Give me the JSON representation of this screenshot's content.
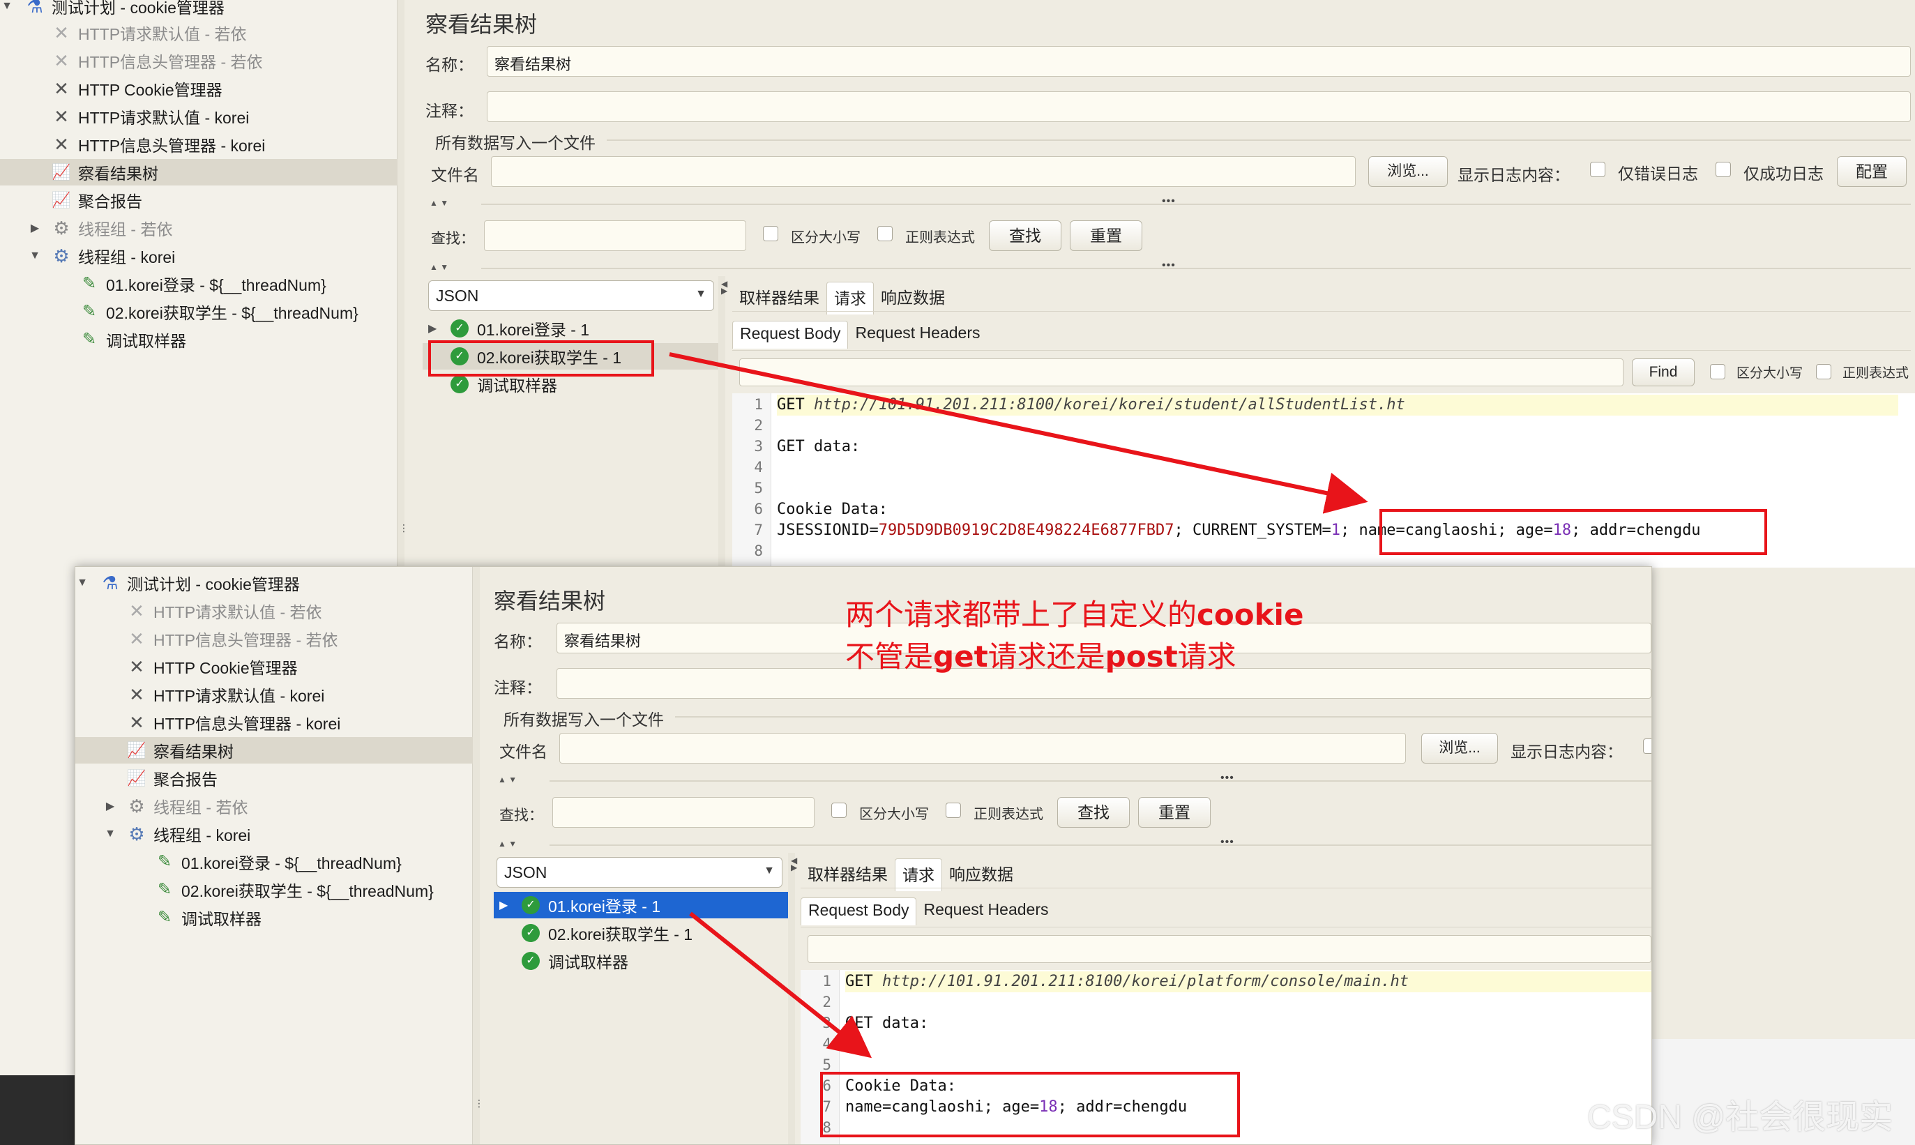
{
  "tree": {
    "root": "测试计划 - cookie管理器",
    "items": [
      {
        "label": "HTTP请求默认值 - 若依",
        "icon": "tool-icon",
        "disabled": true
      },
      {
        "label": "HTTP信息头管理器 - 若依",
        "icon": "tool-icon",
        "disabled": true
      },
      {
        "label": "HTTP Cookie管理器",
        "icon": "tool-icon",
        "disabled": false
      },
      {
        "label": "HTTP请求默认值 - korei",
        "icon": "tool-icon",
        "disabled": false
      },
      {
        "label": "HTTP信息头管理器 - korei",
        "icon": "tool-icon",
        "disabled": false
      },
      {
        "label": "察看结果树",
        "icon": "chart-icon",
        "disabled": false
      },
      {
        "label": "聚合报告",
        "icon": "chart-icon",
        "disabled": false
      },
      {
        "label": "线程组 - 若依",
        "icon": "gear-icon",
        "disabled": true
      },
      {
        "label": "线程组 - korei",
        "icon": "gear-icon",
        "disabled": false
      },
      {
        "label": "01.korei登录 - ${__threadNum}",
        "icon": "pipette-icon",
        "disabled": false
      },
      {
        "label": "02.korei获取学生 - ${__threadNum}",
        "icon": "pipette-icon",
        "disabled": false
      },
      {
        "label": "调试取样器",
        "icon": "pipette-icon",
        "disabled": false
      }
    ]
  },
  "panel": {
    "title": "察看结果树",
    "name_label": "名称：",
    "name_value": "察看结果树",
    "comment_label": "注释：",
    "file_section": "所有数据写入一个文件",
    "file_label": "文件名",
    "browse": "浏览...",
    "log_label": "显示日志内容：",
    "errors_only": "仅错误日志",
    "success_only": "仅成功日志",
    "config": "配置",
    "search_label": "查找：",
    "case_sensitive": "区分大小写",
    "regex": "正则表达式",
    "find_btn": "查找",
    "reset_btn": "重置",
    "renderer": "JSON",
    "tabs": [
      "取样器结果",
      "请求",
      "响应数据"
    ],
    "subtabs": [
      "Request Body",
      "Request Headers"
    ],
    "find_small": "Find",
    "results": [
      "01.korei登录 - 1",
      "02.korei获取学生 - 1",
      "调试取样器"
    ]
  },
  "top_code": {
    "l1_kw": "GET",
    "l1_url": "http://101.91.201.211:8100/korei/korei/student/allStudentList.ht",
    "l3": "GET data:",
    "l6": "Cookie Data:",
    "l7_a": "JSESSIONID=",
    "l7_b": "79D5D9DB0919C2D8E498224E6877FBD7",
    "l7_c": "; CURRENT_SYSTEM=",
    "l7_d": "1",
    "l7_e": "; ",
    "l7_f": "name=canglaoshi; age=",
    "l7_g": "18",
    "l7_h": "; addr=chengdu"
  },
  "bottom_code": {
    "l1_kw": "GET",
    "l1_url": "http://101.91.201.211:8100/korei/platform/console/main.ht",
    "l3": "GET data:",
    "l6": "Cookie Data:",
    "l7_a": "name=canglaoshi; age=",
    "l7_b": "18",
    "l7_c": "; addr=chengdu"
  },
  "annotation": {
    "line1_a": "两个请求都带上了自定义的",
    "line1_b": "cookie",
    "line2_a": "不管是",
    "line2_b": "get",
    "line2_c": "请求还是",
    "line2_d": "post",
    "line2_e": "请求"
  },
  "watermark": "CSDN @社会很现实",
  "colors": {
    "annotation_red": "#e8141a",
    "selection_blue": "#1e66d2",
    "ok_green": "#2e9b3c"
  }
}
